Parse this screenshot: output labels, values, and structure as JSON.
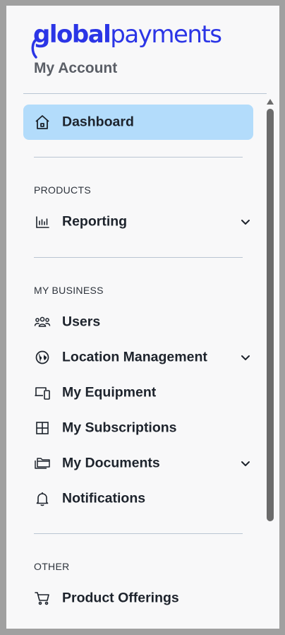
{
  "brand": {
    "logo_part1": "global",
    "logo_part2": "payments",
    "color": "#2b35e6"
  },
  "account": {
    "title": "My Account"
  },
  "nav": {
    "dashboard": {
      "label": "Dashboard",
      "icon": "home-icon",
      "active": true
    },
    "sections": [
      {
        "label": "PRODUCTS",
        "items": [
          {
            "label": "Reporting",
            "icon": "bar-chart-icon",
            "expandable": true
          }
        ]
      },
      {
        "label": "MY BUSINESS",
        "items": [
          {
            "label": "Users",
            "icon": "users-icon",
            "expandable": false
          },
          {
            "label": "Location Management",
            "icon": "globe-icon",
            "expandable": true
          },
          {
            "label": "My Equipment",
            "icon": "devices-icon",
            "expandable": false
          },
          {
            "label": "My Subscriptions",
            "icon": "grid-icon",
            "expandable": false
          },
          {
            "label": "My Documents",
            "icon": "folders-icon",
            "expandable": true
          },
          {
            "label": "Notifications",
            "icon": "bell-icon",
            "expandable": false
          }
        ]
      },
      {
        "label": "OTHER",
        "items": [
          {
            "label": "Product Offerings",
            "icon": "cart-icon",
            "expandable": false
          }
        ]
      }
    ]
  },
  "colors": {
    "active_bg": "#b3dcfb",
    "divider": "#b9c5d3",
    "text": "#1d232c"
  }
}
